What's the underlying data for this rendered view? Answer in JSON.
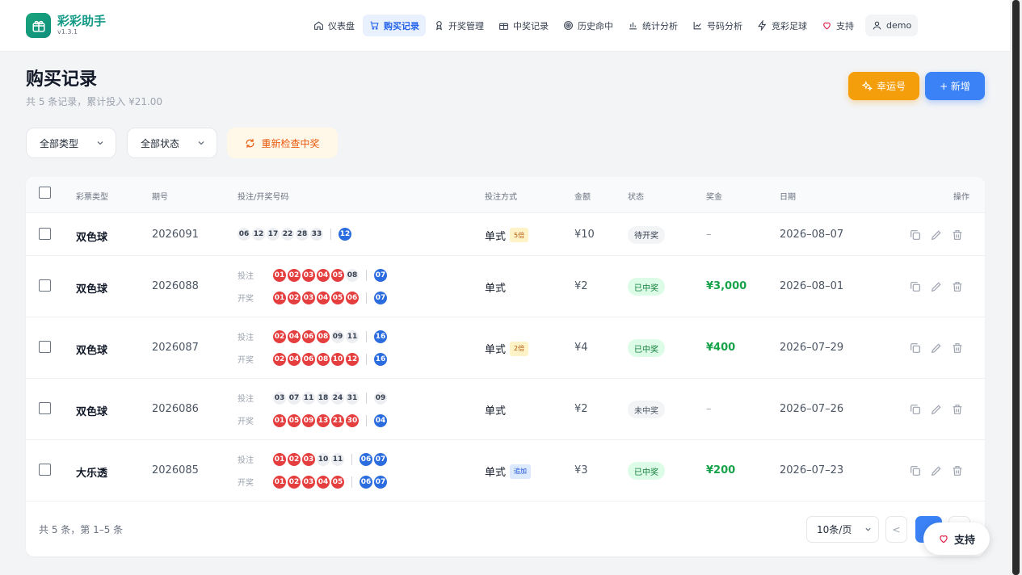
{
  "brand": {
    "title": "彩彩助手",
    "version": "v1.3.1"
  },
  "nav": [
    {
      "label": "仪表盘",
      "icon": "home-icon",
      "active": false
    },
    {
      "label": "购买记录",
      "icon": "cart-icon",
      "active": true
    },
    {
      "label": "开奖管理",
      "icon": "award-icon",
      "active": false
    },
    {
      "label": "中奖记录",
      "icon": "gift-icon",
      "active": false
    },
    {
      "label": "历史命中",
      "icon": "target-icon",
      "active": false
    },
    {
      "label": "统计分析",
      "icon": "bar-chart-icon",
      "active": false
    },
    {
      "label": "号码分析",
      "icon": "line-chart-icon",
      "active": false
    },
    {
      "label": "竞彩足球",
      "icon": "zap-icon",
      "active": false
    },
    {
      "label": "支持",
      "icon": "heart-icon",
      "active": false
    },
    {
      "label": "demo",
      "icon": "user-icon",
      "active": false
    }
  ],
  "page": {
    "title": "购买记录",
    "subtitle": "共 5 条记录，累计投入 ¥21.00",
    "lucky_button": "幸运号",
    "new_button": "+ 新增"
  },
  "filters": {
    "type": "全部类型",
    "status": "全部状态",
    "recheck": "重新检查中奖"
  },
  "table": {
    "headers": [
      "彩票类型",
      "期号",
      "投注/开奖号码",
      "投注方式",
      "金额",
      "状态",
      "奖金",
      "日期",
      "操作"
    ],
    "line_labels": {
      "bet": "投注",
      "draw": "开奖"
    },
    "rows": [
      {
        "type": "双色球",
        "issue": "2026091",
        "bet": {
          "front": [
            [
              "06",
              "gray"
            ],
            [
              "12",
              "gray"
            ],
            [
              "17",
              "gray"
            ],
            [
              "22",
              "gray"
            ],
            [
              "28",
              "gray"
            ],
            [
              "33",
              "gray"
            ]
          ],
          "back": [
            [
              "12",
              "blue"
            ]
          ]
        },
        "draw": null,
        "method": "单式",
        "tag": "5倍",
        "tag_color": "yellow",
        "amount": "¥10",
        "status": "待开奖",
        "status_kind": "wait",
        "prize": "–",
        "prize_kind": "none",
        "date": "2026–08–07"
      },
      {
        "type": "双色球",
        "issue": "2026088",
        "bet": {
          "front": [
            [
              "01",
              "red"
            ],
            [
              "02",
              "red"
            ],
            [
              "03",
              "red"
            ],
            [
              "04",
              "red"
            ],
            [
              "05",
              "red"
            ],
            [
              "08",
              "gray"
            ]
          ],
          "back": [
            [
              "07",
              "blue"
            ]
          ]
        },
        "draw": {
          "front": [
            [
              "01",
              "red"
            ],
            [
              "02",
              "red"
            ],
            [
              "03",
              "red"
            ],
            [
              "04",
              "red"
            ],
            [
              "05",
              "red"
            ],
            [
              "06",
              "red"
            ]
          ],
          "back": [
            [
              "07",
              "blue"
            ]
          ]
        },
        "method": "单式",
        "tag": "",
        "tag_color": "",
        "amount": "¥2",
        "status": "已中奖",
        "status_kind": "win",
        "prize": "¥3,000",
        "prize_kind": "win",
        "date": "2026–08–01"
      },
      {
        "type": "双色球",
        "issue": "2026087",
        "bet": {
          "front": [
            [
              "02",
              "red"
            ],
            [
              "04",
              "red"
            ],
            [
              "06",
              "red"
            ],
            [
              "08",
              "red"
            ],
            [
              "09",
              "gray"
            ],
            [
              "11",
              "gray"
            ]
          ],
          "back": [
            [
              "16",
              "blue"
            ]
          ]
        },
        "draw": {
          "front": [
            [
              "02",
              "red"
            ],
            [
              "04",
              "red"
            ],
            [
              "06",
              "red"
            ],
            [
              "08",
              "red"
            ],
            [
              "10",
              "red"
            ],
            [
              "12",
              "red"
            ]
          ],
          "back": [
            [
              "16",
              "blue"
            ]
          ]
        },
        "method": "单式",
        "tag": "2倍",
        "tag_color": "yellow",
        "amount": "¥4",
        "status": "已中奖",
        "status_kind": "win",
        "prize": "¥400",
        "prize_kind": "win",
        "date": "2026–07–29"
      },
      {
        "type": "双色球",
        "issue": "2026086",
        "bet": {
          "front": [
            [
              "03",
              "gray"
            ],
            [
              "07",
              "gray"
            ],
            [
              "11",
              "gray"
            ],
            [
              "18",
              "gray"
            ],
            [
              "24",
              "gray"
            ],
            [
              "31",
              "gray"
            ]
          ],
          "back": [
            [
              "09",
              "gray"
            ]
          ]
        },
        "draw": {
          "front": [
            [
              "01",
              "red"
            ],
            [
              "05",
              "red"
            ],
            [
              "09",
              "red"
            ],
            [
              "13",
              "red"
            ],
            [
              "21",
              "red"
            ],
            [
              "30",
              "red"
            ]
          ],
          "back": [
            [
              "04",
              "blue"
            ]
          ]
        },
        "method": "单式",
        "tag": "",
        "tag_color": "",
        "amount": "¥2",
        "status": "未中奖",
        "status_kind": "lose",
        "prize": "–",
        "prize_kind": "none",
        "date": "2026–07–26"
      },
      {
        "type": "大乐透",
        "issue": "2026085",
        "bet": {
          "front": [
            [
              "01",
              "red"
            ],
            [
              "02",
              "red"
            ],
            [
              "03",
              "red"
            ],
            [
              "10",
              "gray"
            ],
            [
              "11",
              "gray"
            ]
          ],
          "back": [
            [
              "06",
              "blue"
            ],
            [
              "07",
              "blue"
            ]
          ]
        },
        "draw": {
          "front": [
            [
              "01",
              "red"
            ],
            [
              "02",
              "red"
            ],
            [
              "03",
              "red"
            ],
            [
              "04",
              "red"
            ],
            [
              "05",
              "red"
            ]
          ],
          "back": [
            [
              "06",
              "blue"
            ],
            [
              "07",
              "blue"
            ]
          ]
        },
        "method": "单式",
        "tag": "追加",
        "tag_color": "blue",
        "amount": "¥3",
        "status": "已中奖",
        "status_kind": "win",
        "prize": "¥200",
        "prize_kind": "win",
        "date": "2026–07–23"
      }
    ]
  },
  "footer": {
    "summary": "共 5 条，第 1–5 条",
    "page_size": "10条/页",
    "prev": "<"
  },
  "float_support": "支持",
  "colors": {
    "accent": "#3b82f6",
    "brand": "#139a86",
    "red_ball": "#e53e3e",
    "blue_ball": "#2b6cde",
    "lucky": "#f59e0b",
    "win": "#16a34a"
  }
}
